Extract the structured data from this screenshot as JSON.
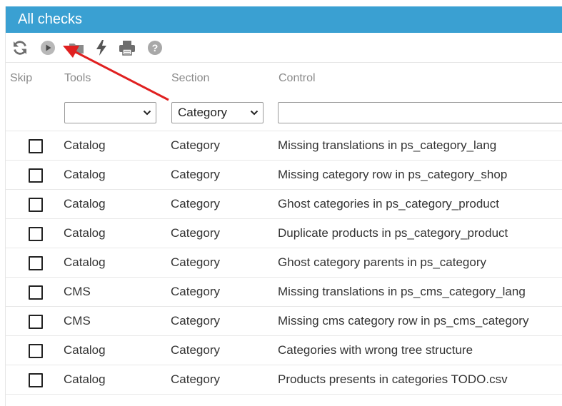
{
  "panel": {
    "title": "All checks"
  },
  "toolbar": {
    "buttons": [
      {
        "icon": "refresh-icon"
      },
      {
        "icon": "play-icon"
      },
      {
        "icon": "folder-icon"
      },
      {
        "icon": "lightning-icon"
      },
      {
        "icon": "print-icon"
      },
      {
        "icon": "help-icon"
      }
    ]
  },
  "table": {
    "columns": [
      "Skip",
      "Tools",
      "Section",
      "Control"
    ],
    "filters": {
      "tools_value": "",
      "section_value": "Category",
      "control_value": ""
    },
    "rows": [
      {
        "tools": "Catalog",
        "section": "Category",
        "control": "Missing translations in ps_category_lang"
      },
      {
        "tools": "Catalog",
        "section": "Category",
        "control": "Missing category row in ps_category_shop"
      },
      {
        "tools": "Catalog",
        "section": "Category",
        "control": "Ghost categories in ps_category_product"
      },
      {
        "tools": "Catalog",
        "section": "Category",
        "control": "Duplicate products in ps_category_product"
      },
      {
        "tools": "Catalog",
        "section": "Category",
        "control": "Ghost category parents in ps_category"
      },
      {
        "tools": "CMS",
        "section": "Category",
        "control": "Missing translations in ps_cms_category_lang"
      },
      {
        "tools": "CMS",
        "section": "Category",
        "control": "Missing cms category row in ps_cms_category"
      },
      {
        "tools": "Catalog",
        "section": "Category",
        "control": "Categories with wrong tree structure"
      },
      {
        "tools": "Catalog",
        "section": "Category",
        "control": "Products presents in categories TODO.csv"
      }
    ]
  },
  "colors": {
    "header_bg": "#3aa0d2",
    "annotation_arrow": "#e02020",
    "icon_gray": "#6e6e6e"
  }
}
